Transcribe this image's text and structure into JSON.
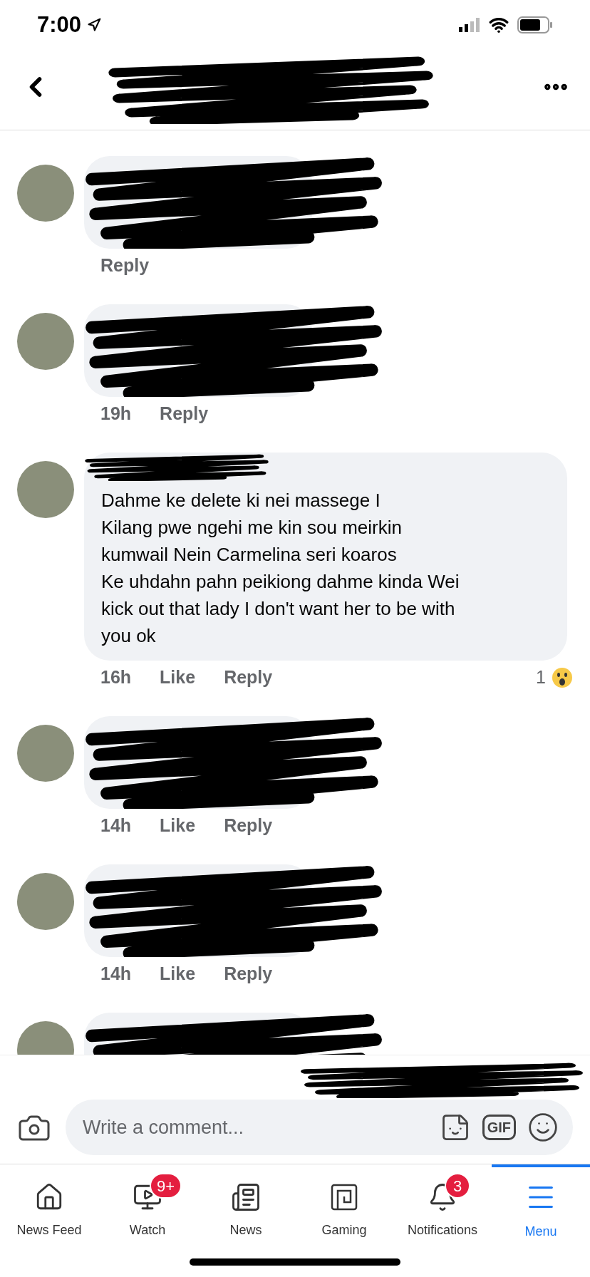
{
  "status_bar": {
    "time": "7:00"
  },
  "comments": [
    {
      "kind": "redacted",
      "reply": "Reply"
    },
    {
      "kind": "redacted",
      "time": "19h",
      "reply": "Reply"
    },
    {
      "kind": "text",
      "text": "Dahme ke delete ki nei massege I\nKilang pwe ngehi me kin sou meirkin\nkumwail Nein Carmelina seri koaros\nKe uhdahn pahn peikiong dahme kinda Wei\nkick out that lady I don't want her to be with\nyou ok",
      "time": "16h",
      "like": "Like",
      "reply": "Reply",
      "reaction_count": "1"
    },
    {
      "kind": "redacted",
      "time": "14h",
      "like": "Like",
      "reply": "Reply"
    },
    {
      "kind": "redacted",
      "time": "14h",
      "like": "Like",
      "reply": "Reply"
    },
    {
      "kind": "redacted"
    }
  ],
  "comment_box": {
    "placeholder": "Write a comment...",
    "gif": "GIF"
  },
  "tabs": [
    {
      "label": "News Feed",
      "selected": false
    },
    {
      "label": "Watch",
      "badge": "9+",
      "selected": false
    },
    {
      "label": "News",
      "selected": false
    },
    {
      "label": "Gaming",
      "selected": false
    },
    {
      "label": "Notifications",
      "badge": "3",
      "selected": false
    },
    {
      "label": "Menu",
      "selected": true
    }
  ]
}
